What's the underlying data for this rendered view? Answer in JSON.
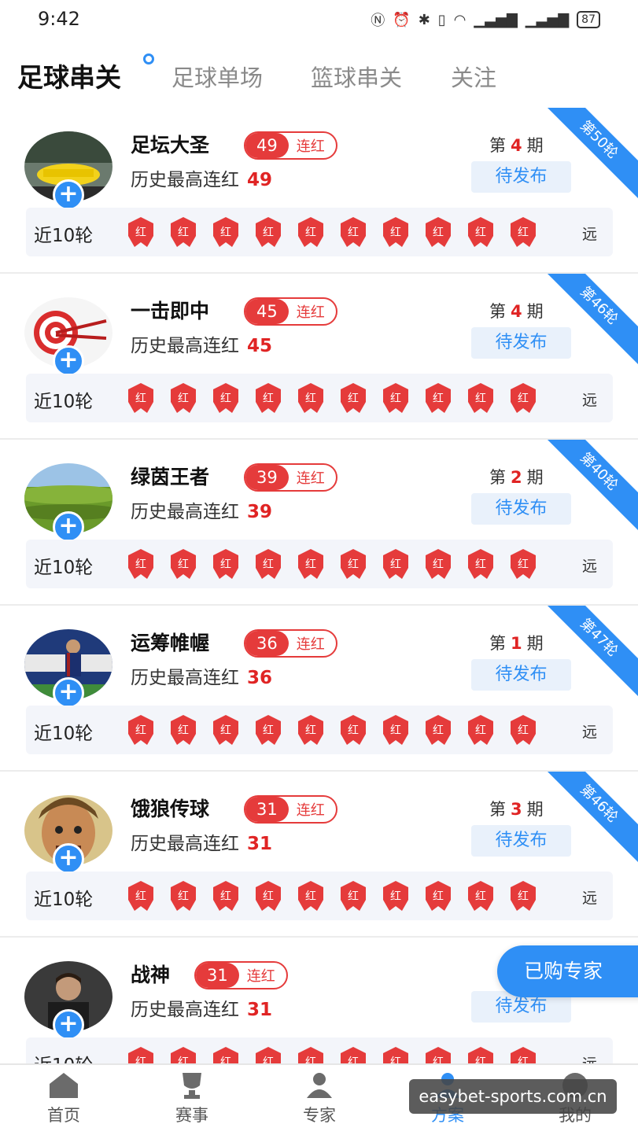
{
  "status": {
    "time": "9:42",
    "icons": [
      "nfc-icon",
      "alarm-icon",
      "bluetooth-icon",
      "vibrate-icon",
      "wifi-icon",
      "signal-4g-icon",
      "signal-4g-icon"
    ],
    "battery": "87"
  },
  "tabs": [
    {
      "label": "足球串关",
      "active": true
    },
    {
      "label": "足球单场",
      "active": false
    },
    {
      "label": "篮球串关",
      "active": false
    },
    {
      "label": "关注",
      "active": false
    }
  ],
  "labels": {
    "streak_label": "连红",
    "history_label": "历史最高连红",
    "period_prefix": "第",
    "period_suffix": "期",
    "pending": "待发布",
    "recent_label": "近10轮",
    "badge_text": "红",
    "far_label": "远"
  },
  "experts": [
    {
      "name": "足坛大圣",
      "streak": "49",
      "history": "49",
      "period": "4",
      "ribbon": "第50轮"
    },
    {
      "name": "一击即中",
      "streak": "45",
      "history": "45",
      "period": "4",
      "ribbon": "第46轮"
    },
    {
      "name": "绿茵王者",
      "streak": "39",
      "history": "39",
      "period": "2",
      "ribbon": "第40轮"
    },
    {
      "name": "运筹帷幄",
      "streak": "36",
      "history": "36",
      "period": "1",
      "ribbon": "第47轮"
    },
    {
      "name": "饿狼传球",
      "streak": "31",
      "history": "31",
      "period": "3",
      "ribbon": "第46轮"
    },
    {
      "name": "战神",
      "streak": "31",
      "history": "31",
      "period": "",
      "ribbon": ""
    }
  ],
  "floating_button": "已购专家",
  "bottom_nav": [
    {
      "label": "首页",
      "icon": "home-icon"
    },
    {
      "label": "赛事",
      "icon": "trophy-icon"
    },
    {
      "label": "专家",
      "icon": "expert-icon"
    },
    {
      "label": "方案",
      "icon": "plan-icon",
      "active": true
    },
    {
      "label": "我的",
      "icon": "profile-icon"
    }
  ],
  "watermark": "easybet-sports.com.cn",
  "colors": {
    "accent": "#2f8ff5",
    "red": "#e53b3b"
  }
}
